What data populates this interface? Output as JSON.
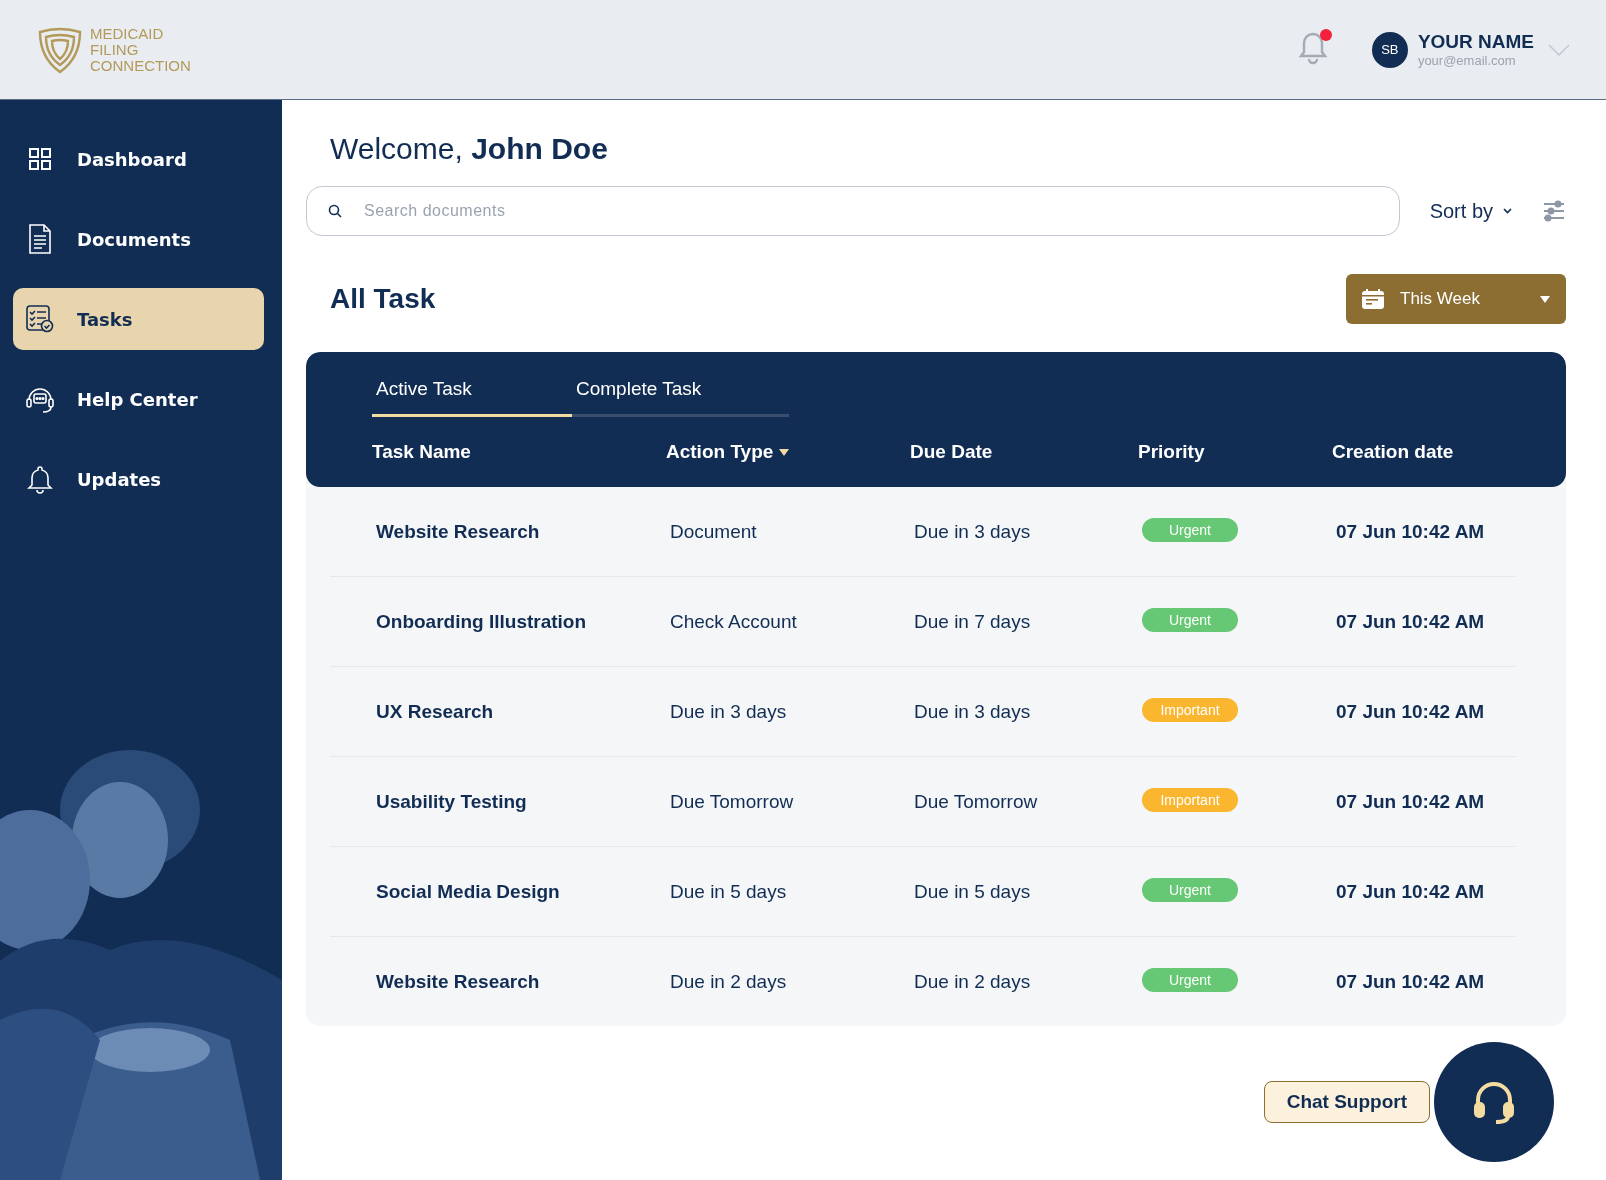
{
  "logo": {
    "lines": [
      "MEDICAID",
      "FILING",
      "CONNECTION"
    ]
  },
  "header": {
    "notification_dot": true,
    "user": {
      "initials": "SB",
      "name": "YOUR NAME",
      "email": "your@email.com"
    }
  },
  "sidebar": {
    "items": [
      {
        "label": "Dashboard",
        "selected": false
      },
      {
        "label": "Documents",
        "selected": false
      },
      {
        "label": "Tasks",
        "selected": true
      },
      {
        "label": "Help Center",
        "selected": false
      },
      {
        "label": "Updates",
        "selected": false
      }
    ]
  },
  "welcome": {
    "greeting": "Welcome,",
    "name": "John Doe"
  },
  "search": {
    "placeholder": "Search documents"
  },
  "sort": {
    "label": "Sort by"
  },
  "title": "All Task",
  "period": {
    "label": "This Week"
  },
  "tabs": [
    {
      "label": "Active Task",
      "selected": true
    },
    {
      "label": "Complete Task",
      "selected": false
    }
  ],
  "table": {
    "columns": [
      {
        "label": "Task Name",
        "sortable": false
      },
      {
        "label": "Action Type",
        "sortable": true
      },
      {
        "label": "Due Date",
        "sortable": false
      },
      {
        "label": "Priority",
        "sortable": false
      },
      {
        "label": "Creation date",
        "sortable": false
      }
    ],
    "rows": [
      {
        "task": "Website Research",
        "action": "Document",
        "due": "Due in 3 days",
        "priority": {
          "label": "Urgent",
          "color": "#66c874"
        },
        "created": "07 Jun 10:42 AM"
      },
      {
        "task": "Onboarding Illustration",
        "action": "Check Account",
        "due": "Due in 7 days",
        "priority": {
          "label": "Urgent",
          "color": "#66c874"
        },
        "created": "07 Jun 10:42 AM"
      },
      {
        "task": "UX Research",
        "action": "Due in 3 days",
        "due": "Due in 3 days",
        "priority": {
          "label": "Important",
          "color": "#fbb630"
        },
        "created": "07 Jun 10:42 AM"
      },
      {
        "task": "Usability Testing",
        "action": "Due Tomorrow",
        "due": "Due Tomorrow",
        "priority": {
          "label": "Important",
          "color": "#fbb630"
        },
        "created": "07 Jun 10:42 AM"
      },
      {
        "task": "Social Media Design",
        "action": "Due in 5 days",
        "due": "Due in 5 days",
        "priority": {
          "label": "Urgent",
          "color": "#66c874"
        },
        "created": "07 Jun 10:42 AM"
      },
      {
        "task": "Website Research",
        "action": "Due in 2 days",
        "due": "Due in 2 days",
        "priority": {
          "label": "Urgent",
          "color": "#66c874"
        },
        "created": "07 Jun 10:42 AM"
      }
    ]
  },
  "chat": {
    "label": "Chat Support"
  }
}
